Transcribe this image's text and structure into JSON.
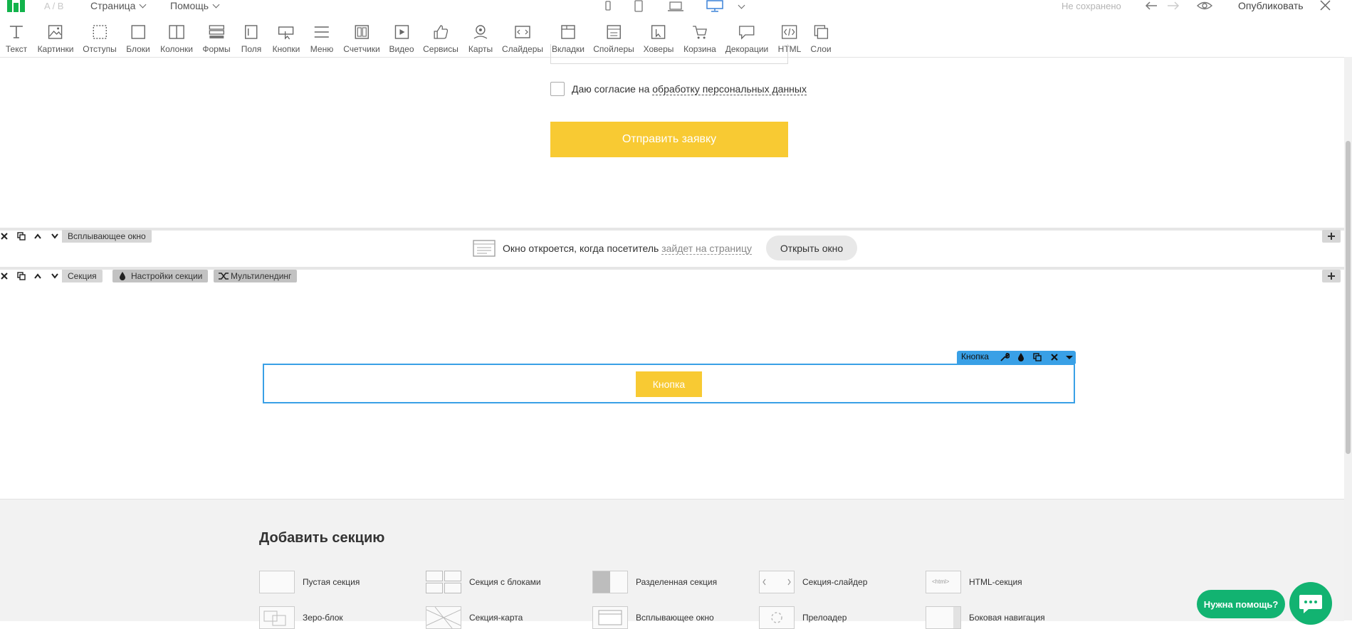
{
  "topbar": {
    "ab_label": "A / B",
    "menu_page": "Страница",
    "menu_help": "Помощь",
    "status": "Не сохранено",
    "publish": "Опубликовать",
    "brand_color": "#12b34b"
  },
  "toolbar": {
    "items": [
      {
        "label": "Текст",
        "icon": "text-icon"
      },
      {
        "label": "Картинки",
        "icon": "image-icon"
      },
      {
        "label": "Отступы",
        "icon": "padding-icon"
      },
      {
        "label": "Блоки",
        "icon": "block-icon"
      },
      {
        "label": "Колонки",
        "icon": "columns-icon"
      },
      {
        "label": "Формы",
        "icon": "form-icon"
      },
      {
        "label": "Поля",
        "icon": "field-icon"
      },
      {
        "label": "Кнопки",
        "icon": "button-icon"
      },
      {
        "label": "Меню",
        "icon": "menu-icon"
      },
      {
        "label": "Счетчики",
        "icon": "counter-icon"
      },
      {
        "label": "Видео",
        "icon": "video-icon"
      },
      {
        "label": "Сервисы",
        "icon": "thumb-up-icon"
      },
      {
        "label": "Карты",
        "icon": "map-pin-icon"
      },
      {
        "label": "Слайдеры",
        "icon": "slider-icon"
      },
      {
        "label": "Вкладки",
        "icon": "tabs-icon"
      },
      {
        "label": "Спойлеры",
        "icon": "spoiler-icon"
      },
      {
        "label": "Ховеры",
        "icon": "hover-icon"
      },
      {
        "label": "Корзина",
        "icon": "cart-icon"
      },
      {
        "label": "Декорации",
        "icon": "speech-bubble-icon"
      },
      {
        "label": "HTML",
        "icon": "code-icon"
      },
      {
        "label": "Слои",
        "icon": "layers-icon"
      }
    ]
  },
  "form": {
    "consent_prefix": "Даю согласие на ",
    "consent_link": "обработку персональных данных",
    "submit_label": "Отправить заявку",
    "accent_color": "#f8ca33"
  },
  "popup_section": {
    "tag": "Всплывающее окно",
    "info_prefix": "Окно откроется, когда посетитель ",
    "info_link": "зайдет на страницу",
    "open_button": "Открыть окно"
  },
  "section": {
    "tag": "Секция",
    "settings": "Настройки секции",
    "multilanding": "Мультилендинг"
  },
  "button_widget": {
    "label": "Кнопка",
    "button_text": "Кнопка",
    "selection_color": "#39a0e6"
  },
  "add_section": {
    "title": "Добавить секцию",
    "types": [
      {
        "label": "Пустая секция"
      },
      {
        "label": "Секция с блоками"
      },
      {
        "label": "Разделенная секция"
      },
      {
        "label": "Секция-слайдер"
      },
      {
        "label": "HTML-секция"
      },
      {
        "label": "Зеро-блок"
      },
      {
        "label": "Секция-карта"
      },
      {
        "label": "Всплывающее окно"
      },
      {
        "label": "Прелоадер"
      },
      {
        "label": "Боковая навигация"
      }
    ]
  },
  "help": {
    "label": "Нужна помощь?"
  }
}
